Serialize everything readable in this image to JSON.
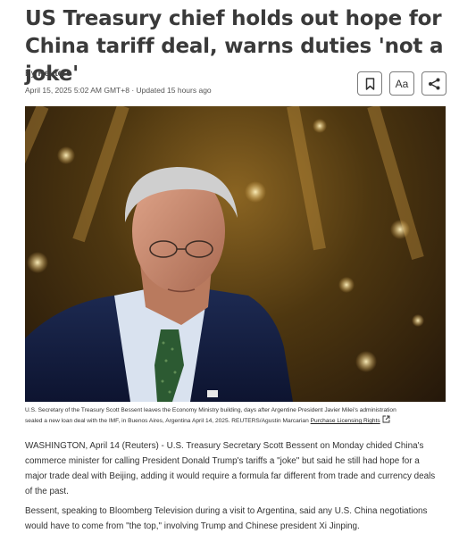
{
  "article": {
    "headline_line1": "US Treasury chief holds out hope for",
    "headline_line2": "China tariff deal, warns duties 'not a joke'",
    "byline_prefix": "By",
    "author": "Reuters",
    "date": "April 15, 2025 5:02 AM GMT+8",
    "separator": "·",
    "updated": "Updated 15 hours ago"
  },
  "actions": {
    "font_size_label": "Aa",
    "bookmark_icon": "bookmark-icon",
    "share_icon": "share-icon"
  },
  "image": {
    "caption_line1": "U.S. Secretary of the Treasury Scott Bessent leaves the Economy Ministry building, days after Argentine President Javier Milei's administration",
    "caption_line2": "sealed a new loan deal with the IMF, in Buenos Aires, Argentina April 14, 2025. REUTERS/Agustin Marcarian",
    "licensing_label": "Purchase Licensing Rights",
    "external_icon": "external-link-icon"
  },
  "body": {
    "p1_l1": "WASHINGTON, April 14 (Reuters) - U.S. Treasury Secretary Scott Bessent on Monday chided China's",
    "p1_l2": "commerce minister for calling President Donald Trump's tariffs a \"joke\" but said he still had hope for a",
    "p1_l3": "major trade deal with Beijing, adding it would require a formula far different from trade and currency deals",
    "p1_l4": "of the past.",
    "p2_l1": "Bessent, speaking to Bloomberg Television during a visit to Argentina, said any U.S. China negotiations",
    "p2_l2": "would have to come from \"the top,\" involving Trump and Chinese president Xi Jinping."
  }
}
